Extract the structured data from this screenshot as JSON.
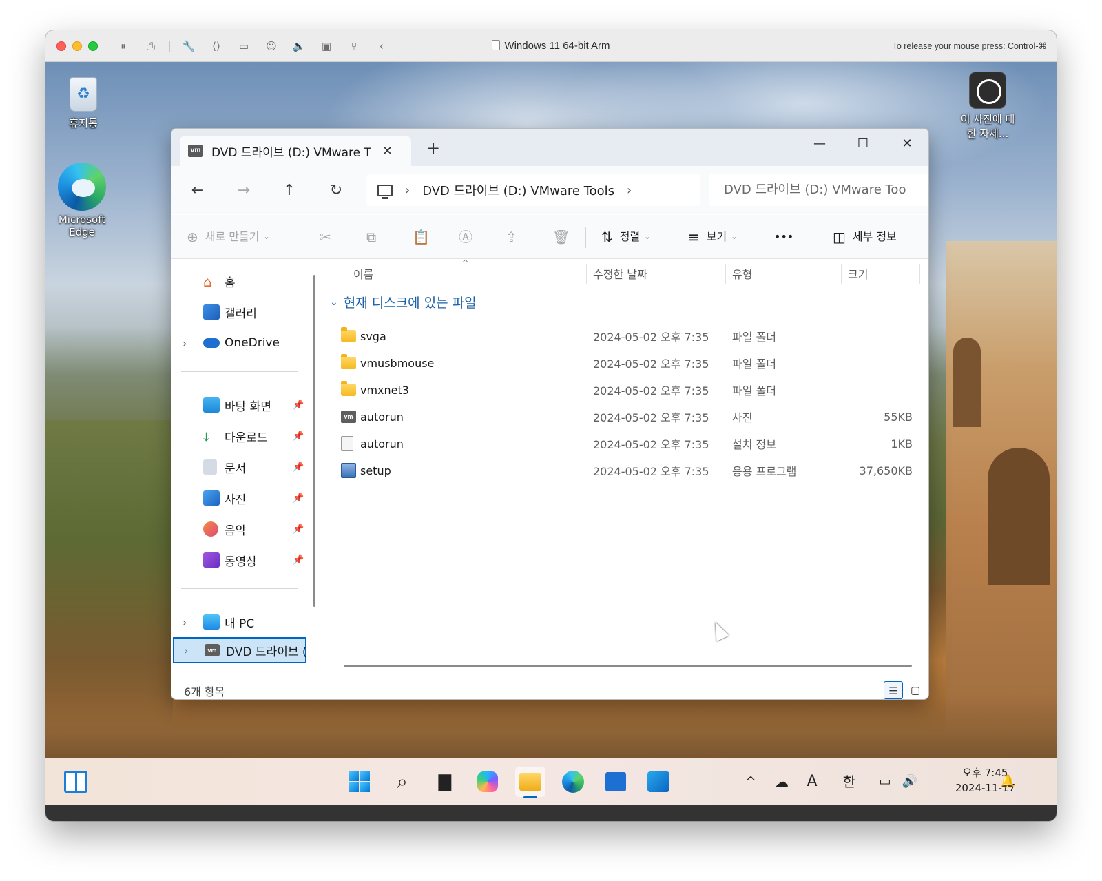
{
  "vm": {
    "title": "Windows 11 64-bit Arm",
    "release_hint": "To release your mouse press: Control-⌘"
  },
  "desktop": {
    "icons": [
      {
        "label": "휴지통",
        "icon": "recycle-bin-icon"
      },
      {
        "label": "Microsoft Edge",
        "icon": "edge-icon"
      },
      {
        "label": "이 사진에 대한 자세...",
        "icon": "learn-about-photo-icon"
      }
    ]
  },
  "explorer": {
    "tab_title": "DVD 드라이브 (D:) VMware T",
    "tab_badge": "vm",
    "new_tab": "+",
    "window_controls": {
      "minimize": "—",
      "maximize": "☐",
      "close": "✕"
    },
    "nav": {
      "back": "←",
      "forward": "→",
      "up": "↑",
      "refresh": "↻"
    },
    "address": {
      "chev1": "›",
      "crumb": "DVD 드라이브 (D:) VMware Tools",
      "chev2": "›"
    },
    "search_text": "DVD 드라이브 (D:) VMware Too",
    "toolbar": {
      "new_label": "새로 만들기",
      "sort_label": "정렬",
      "view_label": "보기",
      "more": "•••",
      "details_label": "세부 정보"
    },
    "sidebar": {
      "quick": [
        {
          "label": "홈",
          "icon": "home-icon"
        },
        {
          "label": "갤러리",
          "icon": "gallery-icon"
        },
        {
          "label": "OneDrive",
          "icon": "onedrive-icon"
        }
      ],
      "pinned": [
        {
          "label": "바탕 화면",
          "icon": "desktop-folder-icon"
        },
        {
          "label": "다운로드",
          "icon": "downloads-icon"
        },
        {
          "label": "문서",
          "icon": "documents-icon"
        },
        {
          "label": "사진",
          "icon": "pictures-icon"
        },
        {
          "label": "음악",
          "icon": "music-icon"
        },
        {
          "label": "동영상",
          "icon": "videos-icon"
        }
      ],
      "devices": [
        {
          "label": "내 PC",
          "icon": "this-pc-icon"
        },
        {
          "label": "DVD 드라이브 (",
          "icon": "dvd-drive-icon"
        }
      ]
    },
    "columns": {
      "name": "이름",
      "date": "수정한 날짜",
      "type": "유형",
      "size": "크기"
    },
    "group_label": "현재 디스크에 있는 파일",
    "files": [
      {
        "name": "svga",
        "date": "2024-05-02 오후 7:35",
        "type": "파일 폴더",
        "size": "",
        "icon": "folder-icon"
      },
      {
        "name": "vmusbmouse",
        "date": "2024-05-02 오후 7:35",
        "type": "파일 폴더",
        "size": "",
        "icon": "folder-icon"
      },
      {
        "name": "vmxnet3",
        "date": "2024-05-02 오후 7:35",
        "type": "파일 폴더",
        "size": "",
        "icon": "folder-icon"
      },
      {
        "name": "autorun",
        "date": "2024-05-02 오후 7:35",
        "type": "사진",
        "size": "55KB",
        "icon": "vmware-image-icon"
      },
      {
        "name": "autorun",
        "date": "2024-05-02 오후 7:35",
        "type": "설치 정보",
        "size": "1KB",
        "icon": "setup-info-icon"
      },
      {
        "name": "setup",
        "date": "2024-05-02 오후 7:35",
        "type": "응용 프로그램",
        "size": "37,650KB",
        "icon": "setup-exe-icon"
      }
    ],
    "status_count": "6개 항목"
  },
  "taskbar": {
    "tray": {
      "ime_mode": "A",
      "ime_lang": "한",
      "chevron": "^"
    },
    "clock": {
      "time": "오후 7:45",
      "date": "2024-11-17"
    }
  }
}
